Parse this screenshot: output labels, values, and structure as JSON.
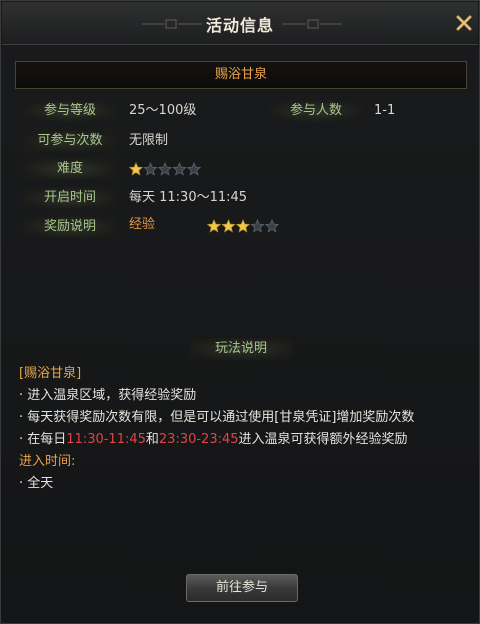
{
  "window": {
    "title": "活动信息"
  },
  "activity": {
    "name": "赐浴甘泉"
  },
  "info": {
    "level_label": "参与等级",
    "level_value": "25～100级",
    "players_label": "参与人数",
    "players_value": "1-1",
    "times_label": "可参与次数",
    "times_value": "无限制",
    "difficulty_label": "难度",
    "difficulty_stars": 1,
    "time_label": "开启时间",
    "time_value": "每天 11:30～11:45",
    "reward_label": "奖励说明",
    "reward_name": "经验",
    "reward_stars": 3,
    "star_total": 5
  },
  "rules": {
    "title": "玩法说明",
    "heading": "[赐浴甘泉]",
    "line1": "· 进入温泉区域，获得经验奖励",
    "line2": "· 每天获得奖励次数有限，但是可以通过使用[甘泉凭证]增加奖励次数",
    "line3_prefix": "· 在每日",
    "line3_time1": "11:30-11:45",
    "line3_and": "和",
    "line3_time2": "23:30-23:45",
    "line3_suffix": "进入温泉可获得额外经验奖励",
    "enter_label": "进入时间:",
    "enter_value": "· 全天"
  },
  "actions": {
    "join_label": "前往参与"
  },
  "colors": {
    "label_green": "#a7c88a",
    "accent_gold": "#e9a24a",
    "time_red": "#e04545",
    "star_gold": "#f2c94c"
  }
}
